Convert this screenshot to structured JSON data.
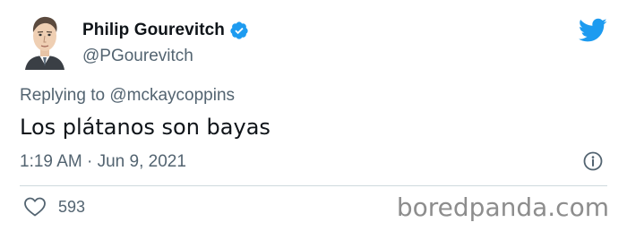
{
  "author": {
    "display_name": "Philip Gourevitch",
    "handle": "@PGourevitch",
    "verified": true
  },
  "reply": {
    "prefix": "Replying to ",
    "user": "@mckaycoppins"
  },
  "tweet": {
    "text": "Los plátanos son bayas",
    "timestamp": "1:19 AM · Jun 9, 2021"
  },
  "engagement": {
    "likes": "593"
  },
  "icons": {
    "verified": "verified-badge-icon",
    "logo": "twitter-bird-icon",
    "info": "info-icon",
    "like": "heart-icon"
  },
  "colors": {
    "brand_blue": "#1d9bf0",
    "text_primary": "#0f1419",
    "text_secondary": "#536471"
  },
  "watermark": "boredpanda.com"
}
